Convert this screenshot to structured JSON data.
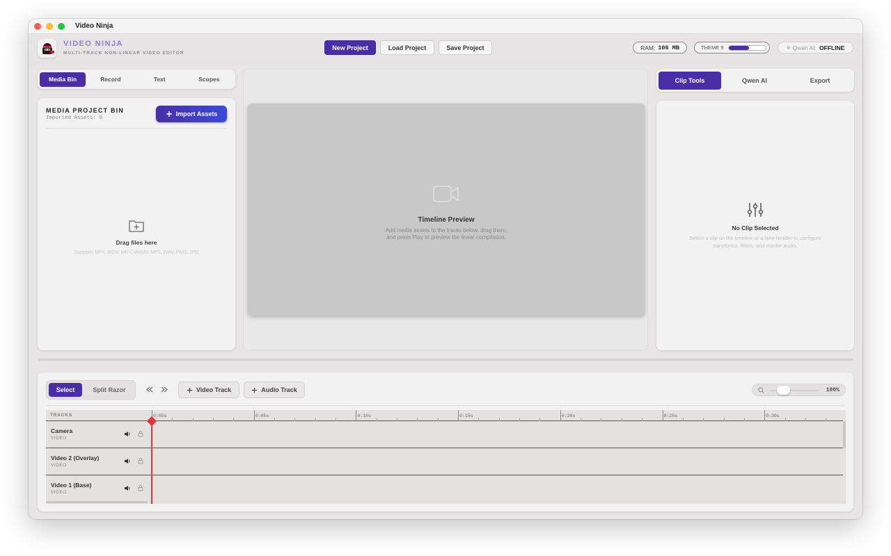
{
  "window": {
    "title": "Video Ninja",
    "traffic_colors": [
      "#fe5f57",
      "#febc2e",
      "#28c840"
    ]
  },
  "brand": {
    "name": "VIDEO NINJA",
    "subtitle": "MULTI-TRACK NON-LINEAR VIDEO EDITOR",
    "accent": "#8b7fe6"
  },
  "header": {
    "new_project": "New Project",
    "load_project": "Load Project",
    "save_project": "Save Project",
    "ram_label": "RAM:",
    "ram_value": "106 MB",
    "theme_label": "THEME 9",
    "qwen_label": "Qwen AI:",
    "qwen_status": "OFFLINE"
  },
  "left_panel": {
    "tabs": [
      "Media Bin",
      "Record",
      "Text",
      "Scopes"
    ],
    "bin_title": "MEDIA PROJECT BIN",
    "bin_count": "Imported Assets: 0",
    "import_label": "Import Assets",
    "drop_title": "Drag files here",
    "drop_formats": "Supports MP4, MOV, MKV, WebM, MP3, WAV, PNG, JPG"
  },
  "preview": {
    "title": "Timeline Preview",
    "line1": "Add media assets to the tracks below, drag them,",
    "line2": "and press Play to preview the linear compilation."
  },
  "right_panel": {
    "tabs": [
      "Clip Tools",
      "Qwen AI",
      "Export"
    ],
    "empty_title": "No Clip Selected",
    "empty_line1": "Select a clip on the timeline or a lane header to configure",
    "empty_line2": "transforms, filters, and master audio."
  },
  "timeline": {
    "mode_select": "Select",
    "mode_razor": "Split Razor",
    "add_video": "Video Track",
    "add_audio": "Audio Track",
    "zoom": "100%",
    "tracks_header": "TRACKS",
    "ticks": [
      "0:00s",
      "0:05s",
      "0:10s",
      "0:15s",
      "0:20s",
      "0:25s",
      "0:30s"
    ],
    "tracks": [
      {
        "name": "Camera",
        "type": "VIDEO"
      },
      {
        "name": "Video 2 (Overlay)",
        "type": "VIDEO"
      },
      {
        "name": "Video 1 (Base)",
        "type": "VIDEO"
      }
    ],
    "playhead_color": "#e8323c"
  }
}
